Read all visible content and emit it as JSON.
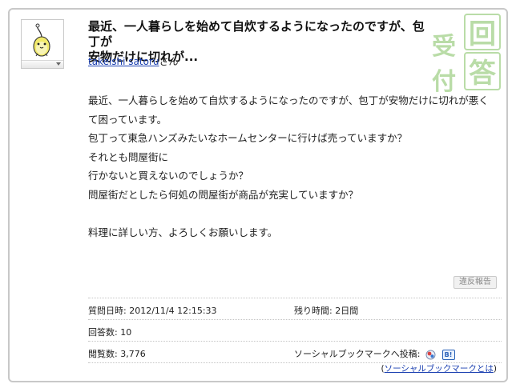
{
  "question": {
    "title_line1": "最近、一人暮らしを始めて自炊するようになったのですが、包丁が",
    "title_line2": "安物だけに切れが...",
    "asker_name": "takeishi satoru",
    "asker_suffix": "さん",
    "body": [
      "最近、一人暮らしを始めて自炊するようになったのですが、包丁が安物だけに切れが悪く",
      "て困っています。",
      "包丁って東急ハンズみたいなホームセンターに行けば売っていますか？",
      "それとも問屋街に",
      "行かないと買えないのでしょうか？",
      "問屋街だとしたら何処の問屋街が商品が充実していますか？",
      "",
      "料理に詳しい方、よろしくお願いします。"
    ],
    "report_label": "違反報告"
  },
  "meta": {
    "posted_label": "質問日時:",
    "posted_value": "2012/11/4 12:15:33",
    "remaining_label": "残り時間:",
    "remaining_value": "2日間",
    "answers_label": "回答数:",
    "answers_value": "10",
    "views_label": "閲覧数:",
    "views_value": "3,776",
    "sbm_label": "ソーシャルブックマークへ投稿:",
    "hatena_label": "B!",
    "sbm_help_open": "(",
    "sbm_help_link": "ソーシャルブックマークとは",
    "sbm_help_close": ")"
  },
  "stamp": {
    "chars": [
      "受",
      "付",
      "回",
      "答"
    ],
    "color": "#b9dca7"
  },
  "colors": {
    "link": "#1a3fb0",
    "border": "#c8c8c8"
  }
}
